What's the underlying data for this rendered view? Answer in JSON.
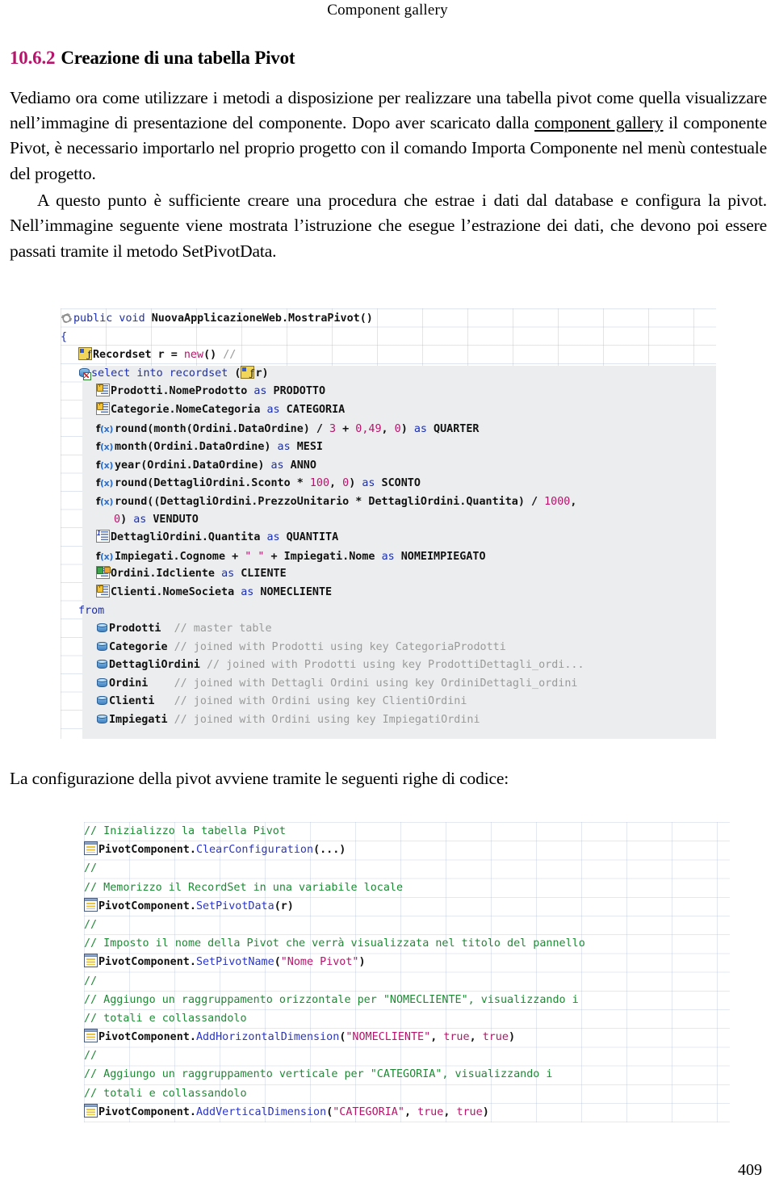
{
  "header": {
    "running_title": "Component gallery"
  },
  "section": {
    "number": "10.6.2",
    "title": "Creazione di una tabella Pivot"
  },
  "paragraphs": {
    "p1_part1": "Vediamo ora come utilizzare i metodi a disposizione per realizzare una tabella pivot come quella visualizzare nell’immagine di presentazione del componente. Dopo aver scaricato dalla ",
    "p1_link": "component gallery",
    "p1_part2": " il componente Pivot, è necessario importarlo nel proprio progetto con il comando Importa Componente nel menù contestuale del progetto.",
    "p2": "A questo punto è sufficiente creare una procedura che estrae i dati dal database e configura la pivot. Nell’immagine seguente viene mostrata l’istruzione che esegue l’estrazione dei dati, che devono poi essere passati tramite il metodo SetPivotData.",
    "p3": "La configurazione della pivot avviene tramite le seguenti righe di codice:"
  },
  "figure_query": {
    "caption_icons": [
      "gear-icon",
      "variable-icon",
      "database-icon",
      "field-icon",
      "function-icon"
    ],
    "lines": [
      {
        "icon": "gear-icon",
        "indent": 0,
        "tokens": [
          {
            "t": "public void ",
            "c": "kw"
          },
          {
            "t": "NuovaApplicazioneWeb.MostraPivot()",
            "c": "id"
          }
        ]
      },
      {
        "icon": "",
        "indent": 0,
        "tokens": [
          {
            "t": "{",
            "c": "kw"
          }
        ]
      },
      {
        "icon": "variable-icon",
        "indent": 1,
        "tokens": [
          {
            "t": "Recordset r = ",
            "c": "id"
          },
          {
            "t": "new",
            "c": "num"
          },
          {
            "t": "() ",
            "c": "id"
          },
          {
            "t": "//",
            "c": "cmt"
          }
        ]
      },
      {
        "icon": "db-select-icon",
        "indent": 1,
        "tokens": [
          {
            "t": "select into recordset",
            "c": "kw"
          },
          {
            "t": " (",
            "c": "id"
          },
          {
            "t": "[var]",
            "c": "inline-var"
          },
          {
            "t": "r)",
            "c": "id"
          }
        ]
      },
      {
        "icon": "field-lock-icon",
        "indent": 2,
        "tokens": [
          {
            "t": "Prodotti.NomeProdotto ",
            "c": "id"
          },
          {
            "t": "as",
            "c": "kw"
          },
          {
            "t": " PRODOTTO",
            "c": "id"
          }
        ]
      },
      {
        "icon": "field-lock-icon",
        "indent": 2,
        "tokens": [
          {
            "t": "Categorie.NomeCategoria ",
            "c": "id"
          },
          {
            "t": "as",
            "c": "kw"
          },
          {
            "t": " CATEGORIA",
            "c": "id"
          }
        ]
      },
      {
        "icon": "fx-icon",
        "indent": 2,
        "tokens": [
          {
            "t": "round(month(Ordini.DataOrdine) / ",
            "c": "id"
          },
          {
            "t": "3",
            "c": "num"
          },
          {
            "t": " + ",
            "c": "id"
          },
          {
            "t": "0,49",
            "c": "num"
          },
          {
            "t": ", ",
            "c": "id"
          },
          {
            "t": "0",
            "c": "num"
          },
          {
            "t": ") ",
            "c": "id"
          },
          {
            "t": "as",
            "c": "kw"
          },
          {
            "t": " QUARTER",
            "c": "id"
          }
        ]
      },
      {
        "icon": "fx-icon",
        "indent": 2,
        "tokens": [
          {
            "t": "month(Ordini.DataOrdine) ",
            "c": "id"
          },
          {
            "t": "as",
            "c": "kw"
          },
          {
            "t": " MESI",
            "c": "id"
          }
        ]
      },
      {
        "icon": "fx-icon",
        "indent": 2,
        "tokens": [
          {
            "t": "year(Ordini.DataOrdine) ",
            "c": "id"
          },
          {
            "t": "as",
            "c": "kw"
          },
          {
            "t": " ANNO",
            "c": "id"
          }
        ]
      },
      {
        "icon": "fx-icon",
        "indent": 2,
        "tokens": [
          {
            "t": "round(DettagliOrdini.Sconto * ",
            "c": "id"
          },
          {
            "t": "100",
            "c": "num"
          },
          {
            "t": ", ",
            "c": "id"
          },
          {
            "t": "0",
            "c": "num"
          },
          {
            "t": ") ",
            "c": "id"
          },
          {
            "t": "as",
            "c": "kw"
          },
          {
            "t": " SCONTO",
            "c": "id"
          }
        ]
      },
      {
        "icon": "fx-icon",
        "indent": 2,
        "tokens": [
          {
            "t": "round((DettagliOrdini.PrezzoUnitario * DettagliOrdini.Quantita) / ",
            "c": "id"
          },
          {
            "t": "1000",
            "c": "num"
          },
          {
            "t": ",",
            "c": "id"
          }
        ]
      },
      {
        "icon": "",
        "indent": 3,
        "tokens": [
          {
            "t": "0",
            "c": "num"
          },
          {
            "t": ") ",
            "c": "id"
          },
          {
            "t": "as",
            "c": "kw"
          },
          {
            "t": " VENDUTO",
            "c": "id"
          }
        ]
      },
      {
        "icon": "field-num-icon",
        "indent": 2,
        "tokens": [
          {
            "t": "DettagliOrdini.Quantita ",
            "c": "id"
          },
          {
            "t": "as",
            "c": "kw"
          },
          {
            "t": " QUANTITA",
            "c": "id"
          }
        ]
      },
      {
        "icon": "fx-icon",
        "indent": 2,
        "tokens": [
          {
            "t": "Impiegati.Cognome + ",
            "c": "id"
          },
          {
            "t": "\" \"",
            "c": "str"
          },
          {
            "t": " + Impiegati.Nome ",
            "c": "id"
          },
          {
            "t": "as",
            "c": "kw"
          },
          {
            "t": " NOMEIMPIEGATO",
            "c": "id"
          }
        ]
      },
      {
        "icon": "field-key-icon",
        "indent": 2,
        "tokens": [
          {
            "t": "Ordini.Idcliente ",
            "c": "id"
          },
          {
            "t": "as",
            "c": "kw"
          },
          {
            "t": " CLIENTE",
            "c": "id"
          }
        ]
      },
      {
        "icon": "field-lock-icon",
        "indent": 2,
        "tokens": [
          {
            "t": "Clienti.NomeSocieta ",
            "c": "id"
          },
          {
            "t": "as",
            "c": "kw"
          },
          {
            "t": " NOMECLIENTE",
            "c": "id"
          }
        ]
      },
      {
        "icon": "",
        "indent": 1,
        "tokens": [
          {
            "t": "from",
            "c": "kw"
          }
        ]
      },
      {
        "icon": "table-icon",
        "indent": 2,
        "tokens": [
          {
            "t": "Prodotti  ",
            "c": "id"
          },
          {
            "t": "// master table",
            "c": "cmt"
          }
        ]
      },
      {
        "icon": "table-icon",
        "indent": 2,
        "tokens": [
          {
            "t": "Categorie ",
            "c": "id"
          },
          {
            "t": "// joined with Prodotti using key CategoriaProdotti",
            "c": "cmt"
          }
        ]
      },
      {
        "icon": "table-icon",
        "indent": 2,
        "tokens": [
          {
            "t": "DettagliOrdini ",
            "c": "id"
          },
          {
            "t": "// joined with Prodotti using key ProdottiDettagli_ordi...",
            "c": "cmt"
          }
        ]
      },
      {
        "icon": "table-icon",
        "indent": 2,
        "tokens": [
          {
            "t": "Ordini    ",
            "c": "id"
          },
          {
            "t": "// joined with Dettagli Ordini using key OrdiniDettagli_ordini",
            "c": "cmt"
          }
        ]
      },
      {
        "icon": "table-icon",
        "indent": 2,
        "tokens": [
          {
            "t": "Clienti   ",
            "c": "id"
          },
          {
            "t": "// joined with Ordini using key ClientiOrdini",
            "c": "cmt"
          }
        ]
      },
      {
        "icon": "table-icon",
        "indent": 2,
        "tokens": [
          {
            "t": "Impiegati ",
            "c": "id"
          },
          {
            "t": "// joined with Ordini using key ImpiegatiOrdini",
            "c": "cmt"
          }
        ]
      }
    ]
  },
  "figure_config": {
    "lines": [
      {
        "icon": "",
        "tokens": [
          {
            "t": "// Inizializzo la tabella Pivot",
            "c": "cmt2"
          }
        ]
      },
      {
        "icon": "component-icon",
        "tokens": [
          {
            "t": "PivotComponent.",
            "c": "id"
          },
          {
            "t": "ClearConfiguration",
            "c": "mth"
          },
          {
            "t": "(...)",
            "c": "id"
          }
        ]
      },
      {
        "icon": "",
        "tokens": [
          {
            "t": "//",
            "c": "cmt2"
          }
        ]
      },
      {
        "icon": "",
        "tokens": [
          {
            "t": "// Memorizzo il RecordSet in una variabile locale",
            "c": "cmt2"
          }
        ]
      },
      {
        "icon": "component-icon",
        "tokens": [
          {
            "t": "PivotComponent.",
            "c": "id"
          },
          {
            "t": "SetPivotData",
            "c": "mth"
          },
          {
            "t": "(r)",
            "c": "id"
          }
        ]
      },
      {
        "icon": "",
        "tokens": [
          {
            "t": "//",
            "c": "cmt2"
          }
        ]
      },
      {
        "icon": "",
        "tokens": [
          {
            "t": "// Imposto il nome della Pivot che verrà visualizzata nel titolo del pannello",
            "c": "cmt2"
          }
        ]
      },
      {
        "icon": "component-icon",
        "tokens": [
          {
            "t": "PivotComponent.",
            "c": "id"
          },
          {
            "t": "SetPivotName",
            "c": "mth"
          },
          {
            "t": "(",
            "c": "id"
          },
          {
            "t": "\"Nome Pivot\"",
            "c": "str"
          },
          {
            "t": ")",
            "c": "id"
          }
        ]
      },
      {
        "icon": "",
        "tokens": [
          {
            "t": "//",
            "c": "cmt2"
          }
        ]
      },
      {
        "icon": "",
        "tokens": [
          {
            "t": "// Aggiungo un raggruppamento orizzontale per \"NOMECLIENTE\", visualizzando i",
            "c": "cmt2"
          }
        ]
      },
      {
        "icon": "",
        "tokens": [
          {
            "t": "// totali e collassandolo",
            "c": "cmt2"
          }
        ]
      },
      {
        "icon": "component-icon",
        "tokens": [
          {
            "t": "PivotComponent.",
            "c": "id"
          },
          {
            "t": "AddHorizontalDimension",
            "c": "mth"
          },
          {
            "t": "(",
            "c": "id"
          },
          {
            "t": "\"NOMECLIENTE\"",
            "c": "str"
          },
          {
            "t": ", ",
            "c": "id"
          },
          {
            "t": "true",
            "c": "bool"
          },
          {
            "t": ", ",
            "c": "id"
          },
          {
            "t": "true",
            "c": "bool"
          },
          {
            "t": ")",
            "c": "id"
          }
        ]
      },
      {
        "icon": "",
        "tokens": [
          {
            "t": "//",
            "c": "cmt2"
          }
        ]
      },
      {
        "icon": "",
        "tokens": [
          {
            "t": "// Aggiungo un raggruppamento verticale per \"CATEGORIA\", visualizzando i",
            "c": "cmt2"
          }
        ]
      },
      {
        "icon": "",
        "tokens": [
          {
            "t": "// totali e collassandolo",
            "c": "cmt2"
          }
        ]
      },
      {
        "icon": "component-icon",
        "tokens": [
          {
            "t": "PivotComponent.",
            "c": "id"
          },
          {
            "t": "AddVerticalDimension",
            "c": "mth"
          },
          {
            "t": "(",
            "c": "id"
          },
          {
            "t": "\"CATEGORIA\"",
            "c": "str"
          },
          {
            "t": ", ",
            "c": "id"
          },
          {
            "t": "true",
            "c": "bool"
          },
          {
            "t": ", ",
            "c": "id"
          },
          {
            "t": "true",
            "c": "bool"
          },
          {
            "t": ")",
            "c": "id"
          }
        ]
      }
    ]
  },
  "footer": {
    "page_number": "409"
  },
  "colors": {
    "keyword": "#1b2fb0",
    "number": "#b5156b",
    "string": "#b5156b",
    "comment_gray": "#9a9a9a",
    "comment_green": "#1f8a35",
    "method": "#2a35c8",
    "code_shade": "#ecedee"
  }
}
